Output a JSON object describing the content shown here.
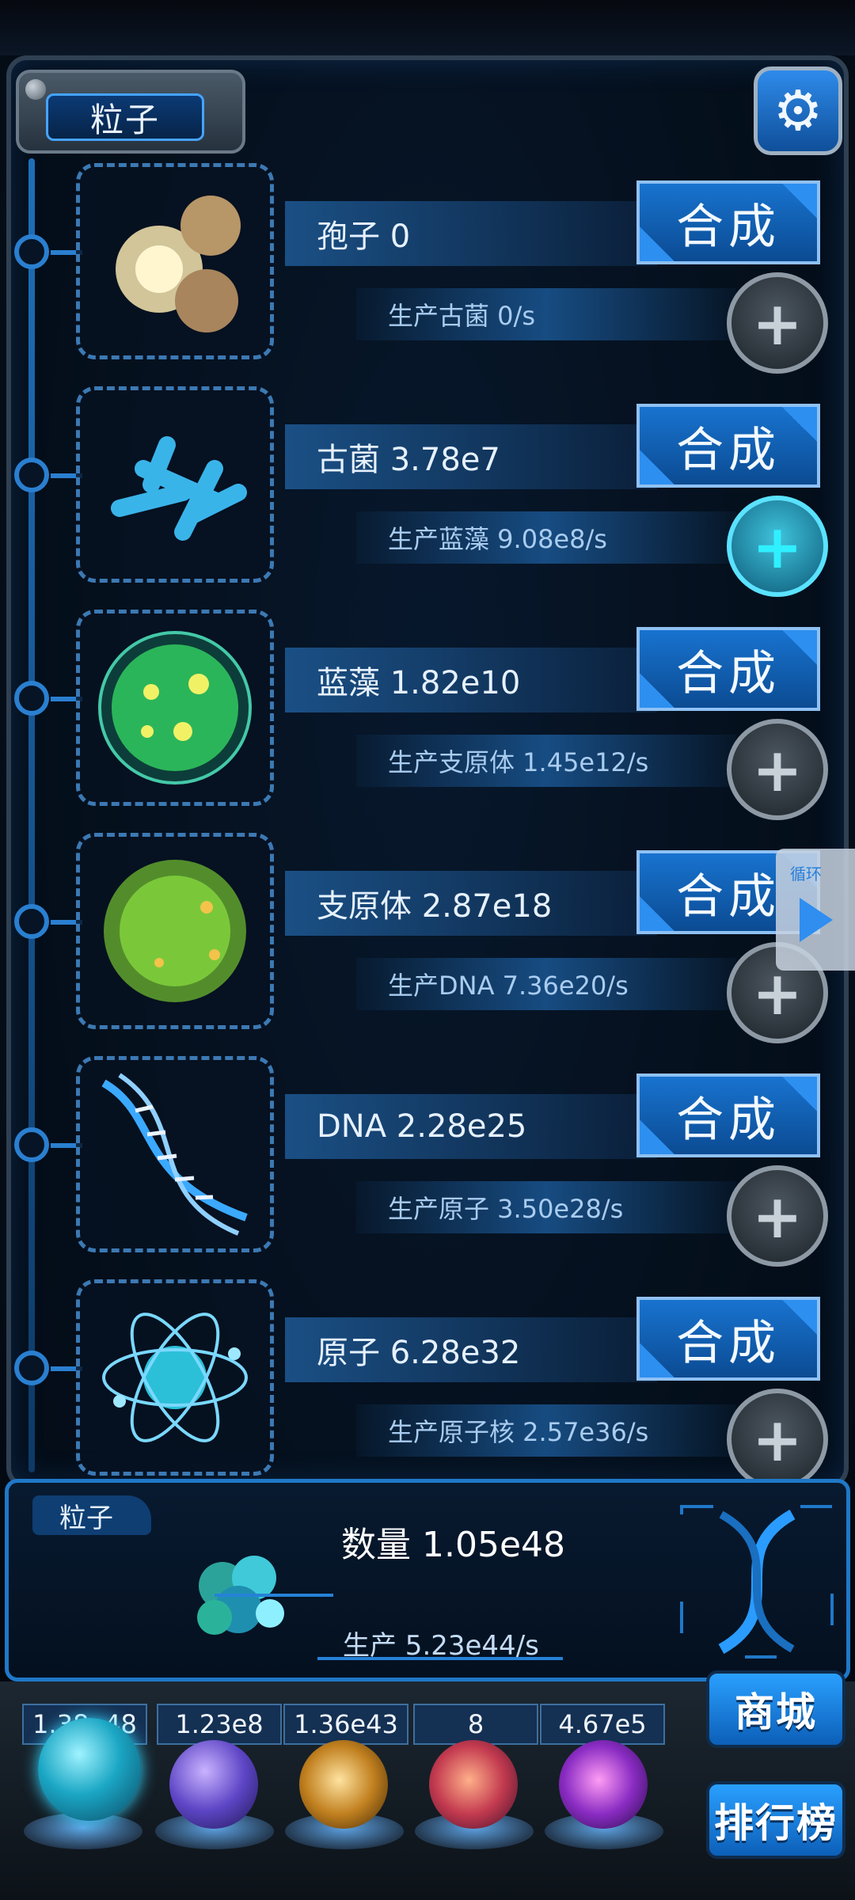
{
  "header": {
    "title": "粒子",
    "settings_icon": "gear-icon"
  },
  "items": [
    {
      "name_label": "孢子 0",
      "production_label": "生产古菌 0/s",
      "synth_label": "合成",
      "plus_active": false,
      "icon": "spore-icon"
    },
    {
      "name_label": "古菌 3.78e7",
      "production_label": "生产蓝藻 9.08e8/s",
      "synth_label": "合成",
      "plus_active": true,
      "icon": "archaea-icon"
    },
    {
      "name_label": "蓝藻 1.82e10",
      "production_label": "生产支原体 1.45e12/s",
      "synth_label": "合成",
      "plus_active": false,
      "icon": "cyanobacteria-icon"
    },
    {
      "name_label": "支原体 2.87e18",
      "production_label": "生产DNA 7.36e20/s",
      "synth_label": "合成",
      "plus_active": false,
      "icon": "mycoplasma-icon"
    },
    {
      "name_label": "DNA 2.28e25",
      "production_label": "生产原子 3.50e28/s",
      "synth_label": "合成",
      "plus_active": false,
      "icon": "dna-icon"
    },
    {
      "name_label": "原子 6.28e32",
      "production_label": "生产原子核 2.57e36/s",
      "synth_label": "合成",
      "plus_active": false,
      "icon": "atom-icon"
    }
  ],
  "loop_button": {
    "label": "循环"
  },
  "summary": {
    "tab_label": "粒子",
    "count_label": "数量 1.05e48",
    "production_label": "生产 5.23e44/s"
  },
  "stats": [
    "1.38e48",
    "1.23e8",
    "1.36e43",
    "8",
    "4.67e5"
  ],
  "side_buttons": {
    "shop": "商城",
    "rank": "排行榜"
  },
  "colors": {
    "accent": "#1873cf",
    "panel": "#081a30",
    "active_plus": "#2ff0ff"
  }
}
